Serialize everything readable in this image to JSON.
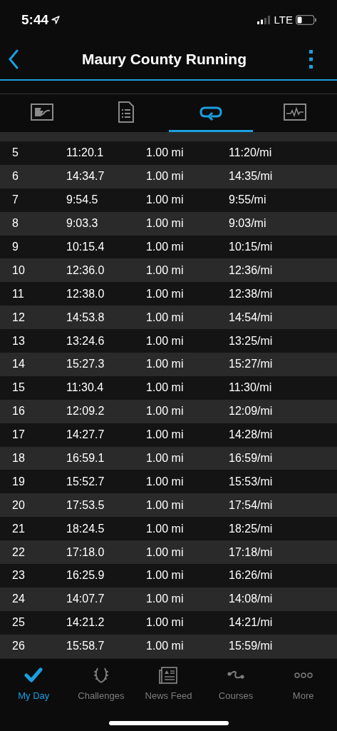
{
  "status_bar": {
    "time": "5:44",
    "network": "LTE"
  },
  "header": {
    "title": "Maury County Running"
  },
  "tabs": [
    {
      "kind": "summary",
      "selected": false
    },
    {
      "kind": "details",
      "selected": false
    },
    {
      "kind": "laps",
      "selected": true
    },
    {
      "kind": "chart",
      "selected": false
    }
  ],
  "laps": [
    [
      "5",
      "11:20.1",
      "1.00 mi",
      "11:20/mi"
    ],
    [
      "6",
      "14:34.7",
      "1.00 mi",
      "14:35/mi"
    ],
    [
      "7",
      "9:54.5",
      "1.00 mi",
      "9:55/mi"
    ],
    [
      "8",
      "9:03.3",
      "1.00 mi",
      "9:03/mi"
    ],
    [
      "9",
      "10:15.4",
      "1.00 mi",
      "10:15/mi"
    ],
    [
      "10",
      "12:36.0",
      "1.00 mi",
      "12:36/mi"
    ],
    [
      "11",
      "12:38.0",
      "1.00 mi",
      "12:38/mi"
    ],
    [
      "12",
      "14:53.8",
      "1.00 mi",
      "14:54/mi"
    ],
    [
      "13",
      "13:24.6",
      "1.00 mi",
      "13:25/mi"
    ],
    [
      "14",
      "15:27.3",
      "1.00 mi",
      "15:27/mi"
    ],
    [
      "15",
      "11:30.4",
      "1.00 mi",
      "11:30/mi"
    ],
    [
      "16",
      "12:09.2",
      "1.00 mi",
      "12:09/mi"
    ],
    [
      "17",
      "14:27.7",
      "1.00 mi",
      "14:28/mi"
    ],
    [
      "18",
      "16:59.1",
      "1.00 mi",
      "16:59/mi"
    ],
    [
      "19",
      "15:52.7",
      "1.00 mi",
      "15:53/mi"
    ],
    [
      "20",
      "17:53.5",
      "1.00 mi",
      "17:54/mi"
    ],
    [
      "21",
      "18:24.5",
      "1.00 mi",
      "18:25/mi"
    ],
    [
      "22",
      "17:18.0",
      "1.00 mi",
      "17:18/mi"
    ],
    [
      "23",
      "16:25.9",
      "1.00 mi",
      "16:26/mi"
    ],
    [
      "24",
      "14:07.7",
      "1.00 mi",
      "14:08/mi"
    ],
    [
      "25",
      "14:21.2",
      "1.00 mi",
      "14:21/mi"
    ],
    [
      "26",
      "15:58.7",
      "1.00 mi",
      "15:59/mi"
    ]
  ],
  "bottom_nav": [
    {
      "kind": "check",
      "label": "My Day",
      "selected": true
    },
    {
      "kind": "laurel",
      "label": "Challenges",
      "selected": false
    },
    {
      "kind": "news",
      "label": "News Feed",
      "selected": false
    },
    {
      "kind": "course",
      "label": "Courses",
      "selected": false
    },
    {
      "kind": "more",
      "label": "More",
      "selected": false
    }
  ]
}
